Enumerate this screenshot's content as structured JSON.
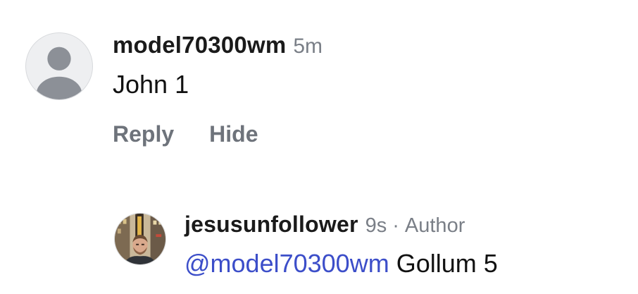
{
  "comment": {
    "avatar_icon": "default-user-avatar-icon",
    "username": "model70300wm",
    "timestamp": "5m",
    "text": "John 1",
    "actions": {
      "reply_label": "Reply",
      "hide_label": "Hide"
    }
  },
  "reply": {
    "avatar_icon": "user-photo-avatar",
    "username": "jesusunfollower",
    "timestamp": "9s",
    "separator": "·",
    "author_label": "Author",
    "mention": "@model70300wm",
    "text": "Gollum 5"
  },
  "colors": {
    "username": "#1a1a1a",
    "meta_gray": "#7a7f87",
    "action_gray": "#6e737b",
    "mention_blue": "#3c4ec9",
    "avatar_bg": "#eeeff1",
    "avatar_figure": "#8c9097"
  }
}
